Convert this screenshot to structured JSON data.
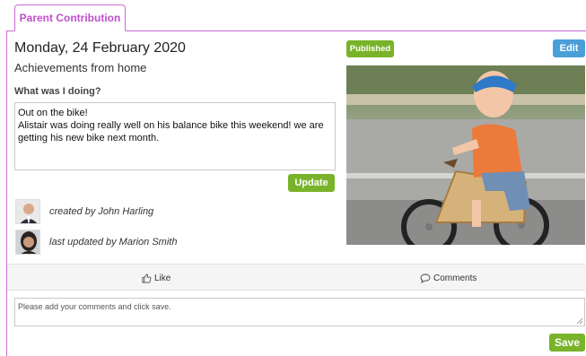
{
  "tab": {
    "label": "Parent Contribution"
  },
  "entry": {
    "date": "Monday, 24 February 2020",
    "title": "Achievements from home",
    "section_label": "What was I doing?",
    "text": "Out on the bike!\nAlistair was doing really well on his balance bike this weekend! we are getting his new bike next month.",
    "update_label": "Update",
    "status": "Published",
    "edit_label": "Edit",
    "created_by": "created by John Harling",
    "updated_by": "last updated by Marion Smith"
  },
  "actions": {
    "like_label": "Like",
    "comments_label": "Comments"
  },
  "comment": {
    "placeholder": "Please add your comments and click save.",
    "save_label": "Save"
  },
  "colors": {
    "accent": "#c96bd2",
    "green": "#79b32a",
    "blue": "#4b9fd9"
  }
}
